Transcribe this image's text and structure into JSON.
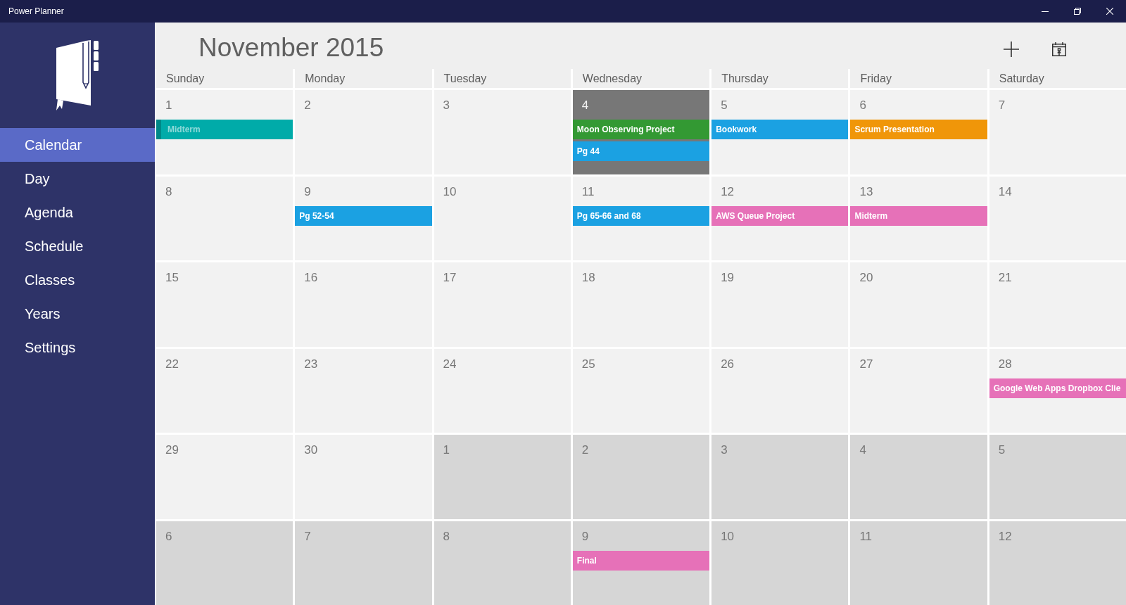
{
  "window": {
    "title": "Power Planner"
  },
  "sidebar": {
    "items": [
      {
        "label": "Calendar",
        "selected": true
      },
      {
        "label": "Day",
        "selected": false
      },
      {
        "label": "Agenda",
        "selected": false
      },
      {
        "label": "Schedule",
        "selected": false
      },
      {
        "label": "Classes",
        "selected": false
      },
      {
        "label": "Years",
        "selected": false
      },
      {
        "label": "Settings",
        "selected": false
      }
    ]
  },
  "calendar": {
    "title": "November 2015",
    "weekdays": [
      "Sunday",
      "Monday",
      "Tuesday",
      "Wednesday",
      "Thursday",
      "Friday",
      "Saturday"
    ],
    "weeks": [
      {
        "days": [
          {
            "day": "1",
            "in_month": true,
            "selected": false,
            "events": [
              {
                "title": "Midterm",
                "color": "#00aba9",
                "completed": true
              }
            ]
          },
          {
            "day": "2",
            "in_month": true,
            "selected": false
          },
          {
            "day": "3",
            "in_month": true,
            "selected": false
          },
          {
            "day": "4",
            "in_month": true,
            "selected": true,
            "events": [
              {
                "title": "Moon Observing Project",
                "color": "#339933",
                "completed": false
              },
              {
                "title": "Pg 44",
                "color": "#1ba1e2",
                "completed": false
              }
            ]
          },
          {
            "day": "5",
            "in_month": true,
            "selected": false,
            "events": [
              {
                "title": "Bookwork",
                "color": "#1ba1e2",
                "completed": false
              }
            ]
          },
          {
            "day": "6",
            "in_month": true,
            "selected": false,
            "events": [
              {
                "title": "Scrum Presentation",
                "color": "#f09609",
                "completed": false
              }
            ]
          },
          {
            "day": "7",
            "in_month": true,
            "selected": false
          }
        ]
      },
      {
        "days": [
          {
            "day": "8",
            "in_month": true,
            "selected": false
          },
          {
            "day": "9",
            "in_month": true,
            "selected": false,
            "events": [
              {
                "title": "Pg 52-54",
                "color": "#1ba1e2",
                "completed": false
              }
            ]
          },
          {
            "day": "10",
            "in_month": true,
            "selected": false
          },
          {
            "day": "11",
            "in_month": true,
            "selected": false,
            "events": [
              {
                "title": "Pg 65-66 and 68",
                "color": "#1ba1e2",
                "completed": false
              }
            ]
          },
          {
            "day": "12",
            "in_month": true,
            "selected": false,
            "events": [
              {
                "title": "AWS Queue Project",
                "color": "#e671b8",
                "completed": false
              }
            ]
          },
          {
            "day": "13",
            "in_month": true,
            "selected": false,
            "events": [
              {
                "title": "Midterm",
                "color": "#e671b8",
                "completed": false
              }
            ]
          },
          {
            "day": "14",
            "in_month": true,
            "selected": false
          }
        ]
      },
      {
        "days": [
          {
            "day": "15",
            "in_month": true,
            "selected": false
          },
          {
            "day": "16",
            "in_month": true,
            "selected": false
          },
          {
            "day": "17",
            "in_month": true,
            "selected": false
          },
          {
            "day": "18",
            "in_month": true,
            "selected": false
          },
          {
            "day": "19",
            "in_month": true,
            "selected": false
          },
          {
            "day": "20",
            "in_month": true,
            "selected": false
          },
          {
            "day": "21",
            "in_month": true,
            "selected": false
          }
        ]
      },
      {
        "days": [
          {
            "day": "22",
            "in_month": true,
            "selected": false
          },
          {
            "day": "23",
            "in_month": true,
            "selected": false
          },
          {
            "day": "24",
            "in_month": true,
            "selected": false
          },
          {
            "day": "25",
            "in_month": true,
            "selected": false
          },
          {
            "day": "26",
            "in_month": true,
            "selected": false
          },
          {
            "day": "27",
            "in_month": true,
            "selected": false
          },
          {
            "day": "28",
            "in_month": true,
            "selected": false,
            "events": [
              {
                "title": "Google Web Apps Dropbox Clie",
                "color": "#e671b8",
                "completed": false
              }
            ]
          }
        ]
      },
      {
        "days": [
          {
            "day": "29",
            "in_month": true,
            "selected": false
          },
          {
            "day": "30",
            "in_month": true,
            "selected": false
          },
          {
            "day": "1",
            "in_month": false,
            "selected": false
          },
          {
            "day": "2",
            "in_month": false,
            "selected": false
          },
          {
            "day": "3",
            "in_month": false,
            "selected": false
          },
          {
            "day": "4",
            "in_month": false,
            "selected": false
          },
          {
            "day": "5",
            "in_month": false,
            "selected": false
          }
        ]
      },
      {
        "days": [
          {
            "day": "6",
            "in_month": false,
            "selected": false
          },
          {
            "day": "7",
            "in_month": false,
            "selected": false
          },
          {
            "day": "8",
            "in_month": false,
            "selected": false
          },
          {
            "day": "9",
            "in_month": false,
            "selected": false,
            "events": [
              {
                "title": "Final",
                "color": "#e671b8",
                "completed": false
              }
            ]
          },
          {
            "day": "10",
            "in_month": false,
            "selected": false
          },
          {
            "day": "11",
            "in_month": false,
            "selected": false
          },
          {
            "day": "12",
            "in_month": false,
            "selected": false
          }
        ]
      }
    ]
  }
}
